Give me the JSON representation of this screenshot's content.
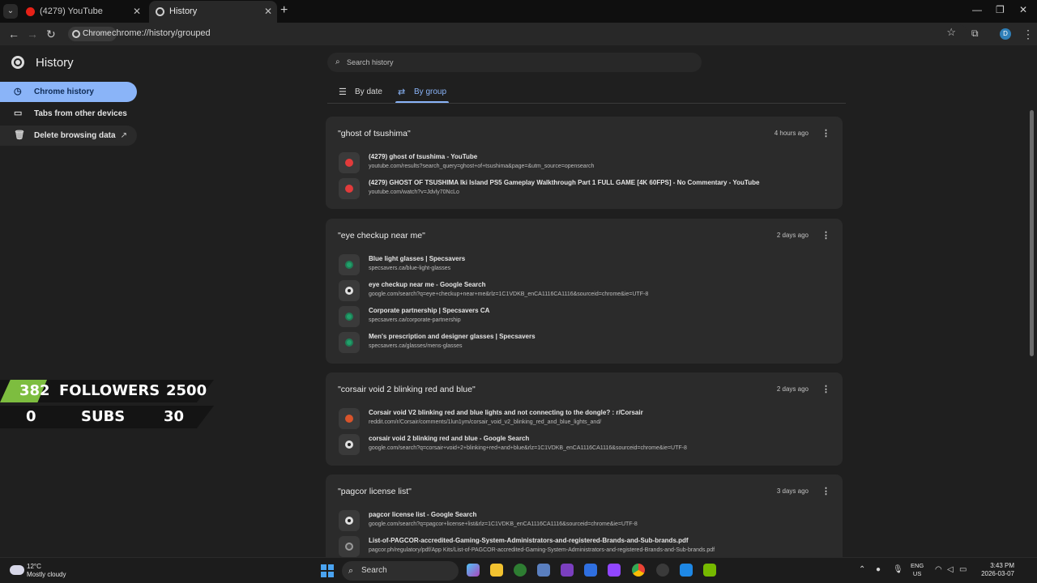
{
  "tabs": [
    {
      "title": "(4279) YouTube",
      "favicon": "youtube-icon"
    },
    {
      "title": "History",
      "favicon": "history-icon"
    }
  ],
  "toolbar": {
    "chip": "Chrome",
    "url": "chrome://history/grouped",
    "avatar": "D"
  },
  "sidebar": {
    "title": "History",
    "items": [
      {
        "label": "Chrome history",
        "icon": "history-icon"
      },
      {
        "label": "Tabs from other devices",
        "icon": "devices-icon"
      },
      {
        "label": "Delete browsing data",
        "icon": "trash-icon"
      }
    ]
  },
  "search": {
    "placeholder": "Search history"
  },
  "view_tabs": [
    {
      "label": "By date",
      "icon": "list-icon"
    },
    {
      "label": "By group",
      "icon": "group-icon"
    }
  ],
  "groups": [
    {
      "title": "\"ghost of tsushima\"",
      "time": "4 hours ago",
      "entries": [
        {
          "title": "(4279) ghost of tsushima - YouTube",
          "url": "youtube.com/results?search_query=ghost+of+tsushima&page=&utm_source=opensearch",
          "favicon": "youtube-icon"
        },
        {
          "title": "(4279) GHOST OF TSUSHIMA Iki Island PS5 Gameplay Walkthrough Part 1 FULL GAME [4K 60FPS] - No Commentary - YouTube",
          "url": "youtube.com/watch?v=Jdvly70NcLo",
          "favicon": "youtube-icon"
        }
      ]
    },
    {
      "title": "\"eye checkup near me\"",
      "time": "2 days ago",
      "entries": [
        {
          "title": "Blue light glasses | Specsavers",
          "url": "specsavers.ca/blue-light-glasses",
          "favicon": "specsavers-icon"
        },
        {
          "title": "eye checkup near me - Google Search",
          "url": "google.com/search?q=eye+checkup+near+me&rlz=1C1VDKB_enCA1116CA1116&sourceid=chrome&ie=UTF-8",
          "favicon": "google-icon"
        },
        {
          "title": "Corporate partnership | Specsavers CA",
          "url": "specsavers.ca/corporate-partnership",
          "favicon": "specsavers-icon"
        },
        {
          "title": "Men's prescription and designer glasses | Specsavers",
          "url": "specsavers.ca/glasses/mens-glasses",
          "favicon": "specsavers-icon"
        }
      ]
    },
    {
      "title": "\"corsair void 2 blinking red and blue\"",
      "time": "2 days ago",
      "entries": [
        {
          "title": "Corsair void V2 blinking red and blue lights and not connecting to the dongle? : r/Corsair",
          "url": "reddit.com/r/Corsair/comments/1lun1ym/corsair_void_v2_blinking_red_and_blue_lights_and/",
          "favicon": "reddit-icon"
        },
        {
          "title": "corsair void 2 blinking red and blue - Google Search",
          "url": "google.com/search?q=corsair+void+2+blinking+red+and+blue&rlz=1C1VDKB_enCA1116CA1116&sourceid=chrome&ie=UTF-8",
          "favicon": "google-icon"
        }
      ]
    },
    {
      "title": "\"pagcor license list\"",
      "time": "3 days ago",
      "entries": [
        {
          "title": "pagcor license list - Google Search",
          "url": "google.com/search?q=pagcor+license+list&rlz=1C1VDKB_enCA1116CA1116&sourceid=chrome&ie=UTF-8",
          "favicon": "google-icon"
        },
        {
          "title": "List-of-PAGCOR-accredited-Gaming-System-Administrators-and-registered-Brands-and-Sub-brands.pdf",
          "url": "pagcor.ph/regulatory/pdf/App Kits/List-of-PAGCOR-accredited-Gaming-System-Administrators-and-registered-Brands-and-Sub-brands.pdf",
          "favicon": "globe-icon"
        }
      ]
    }
  ],
  "overlay": {
    "followers": {
      "current": "382",
      "label": "FOLLOWERS",
      "goal": "2500"
    },
    "subs": {
      "current": "0",
      "label": "SUBS",
      "goal": "30"
    }
  },
  "taskbar": {
    "temperature": "12°C",
    "weather": "Mostly cloudy",
    "search_label": "Search",
    "lang1": "ENG",
    "lang2": "US",
    "time": "3:43 PM",
    "date": "2026-03-07"
  },
  "colors": {
    "accent": "#8ab4f8",
    "overlay_green": "#7dbd3f"
  }
}
